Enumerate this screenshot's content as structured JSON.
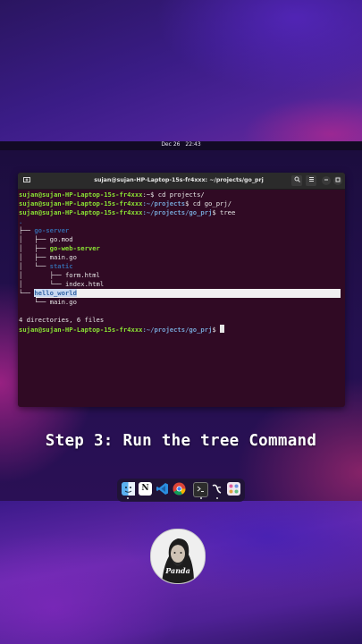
{
  "top_bar": {
    "date": "Dec 26",
    "time": "22:43"
  },
  "terminal": {
    "title": "sujan@sujan-HP-Laptop-15s-fr4xxx: ~/projects/go_prj",
    "new_tab_icon": "new-tab-icon",
    "buttons": [
      "search-icon",
      "menu-icon",
      "minimize-icon",
      "maximize-icon",
      "close-icon"
    ],
    "prompt_user": "sujan@sujan-HP-Laptop-15s-fr4xxx",
    "lines": [
      {
        "path": ":~",
        "cmd": "$ cd projects/"
      },
      {
        "path": ":~/projects",
        "cmd": "$ cd go_prj/"
      },
      {
        "path": ":~/projects/go_prj",
        "cmd": "$ tree"
      }
    ],
    "tree": {
      "root": ".",
      "go_server": "go-server",
      "go_mod": "go.mod",
      "go_web_server": "go-web-server",
      "main_go": "main.go",
      "static": "static",
      "form_html": "form.html",
      "index_html": "index.html",
      "hello_world": "hello_world",
      "main_go_2": "main.go"
    },
    "summary": "4 directories, 6 files",
    "final_prompt_path": ":~/projects/go_prj",
    "final_prompt_cmd": "$ "
  },
  "caption": "Step 3: Run the tree Command",
  "dock": {
    "items": [
      "finder-icon",
      "notion-icon",
      "vscode-icon",
      "chrome-icon",
      "terminal-icon",
      "inkscape-icon",
      "app-grid-icon"
    ]
  },
  "avatar": {
    "signature": "Panda"
  },
  "colors": {
    "terminal_bg": "#300a24",
    "user_green": "#8ae234",
    "path_blue": "#729fcf",
    "dir_blue": "#3465a4"
  }
}
